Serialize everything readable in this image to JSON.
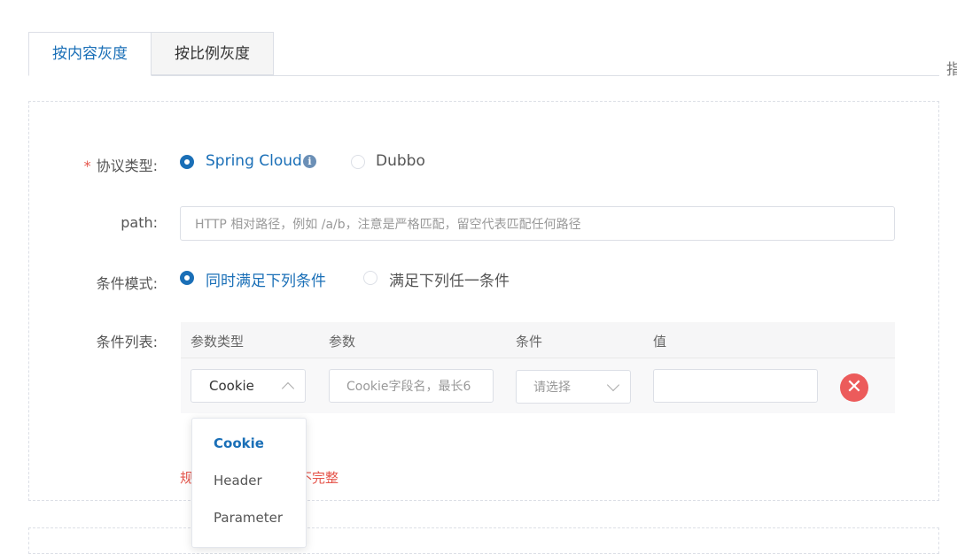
{
  "tabs": [
    {
      "label": "按内容灰度",
      "active": true
    },
    {
      "label": "按比例灰度",
      "active": false
    }
  ],
  "edge_char": "指",
  "form": {
    "protocol": {
      "label": "协议类型:",
      "required_mark": "*",
      "options": [
        {
          "label": "Spring Cloud",
          "checked": true
        },
        {
          "label": "Dubbo",
          "checked": false
        }
      ],
      "info_icon": "i"
    },
    "path": {
      "label": "path:",
      "placeholder": "HTTP 相对路径，例如 /a/b，注意是严格匹配，留空代表匹配任何路径",
      "value": ""
    },
    "mode": {
      "label": "条件模式:",
      "options": [
        {
          "label": "同时满足下列条件",
          "checked": true
        },
        {
          "label": "满足下列任一条件",
          "checked": false
        }
      ]
    },
    "conditions": {
      "label": "条件列表:",
      "headers": [
        "参数类型",
        "参数",
        "条件",
        "值"
      ],
      "row": {
        "param_type": "Cookie",
        "param_placeholder": "Cookie字段名，最长6",
        "condition_placeholder": "请选择",
        "value": "",
        "delete_icon": "✕"
      }
    },
    "error_message": {
      "prefix": "规",
      "suffix": "不完整"
    }
  },
  "dropdown": {
    "options": [
      {
        "label": "Cookie",
        "selected": true
      },
      {
        "label": "Header",
        "selected": false
      },
      {
        "label": "Parameter",
        "selected": false
      }
    ]
  },
  "colors": {
    "primary": "#1a6fb7",
    "danger": "#ec5b5b",
    "error_text": "#e5544a"
  }
}
